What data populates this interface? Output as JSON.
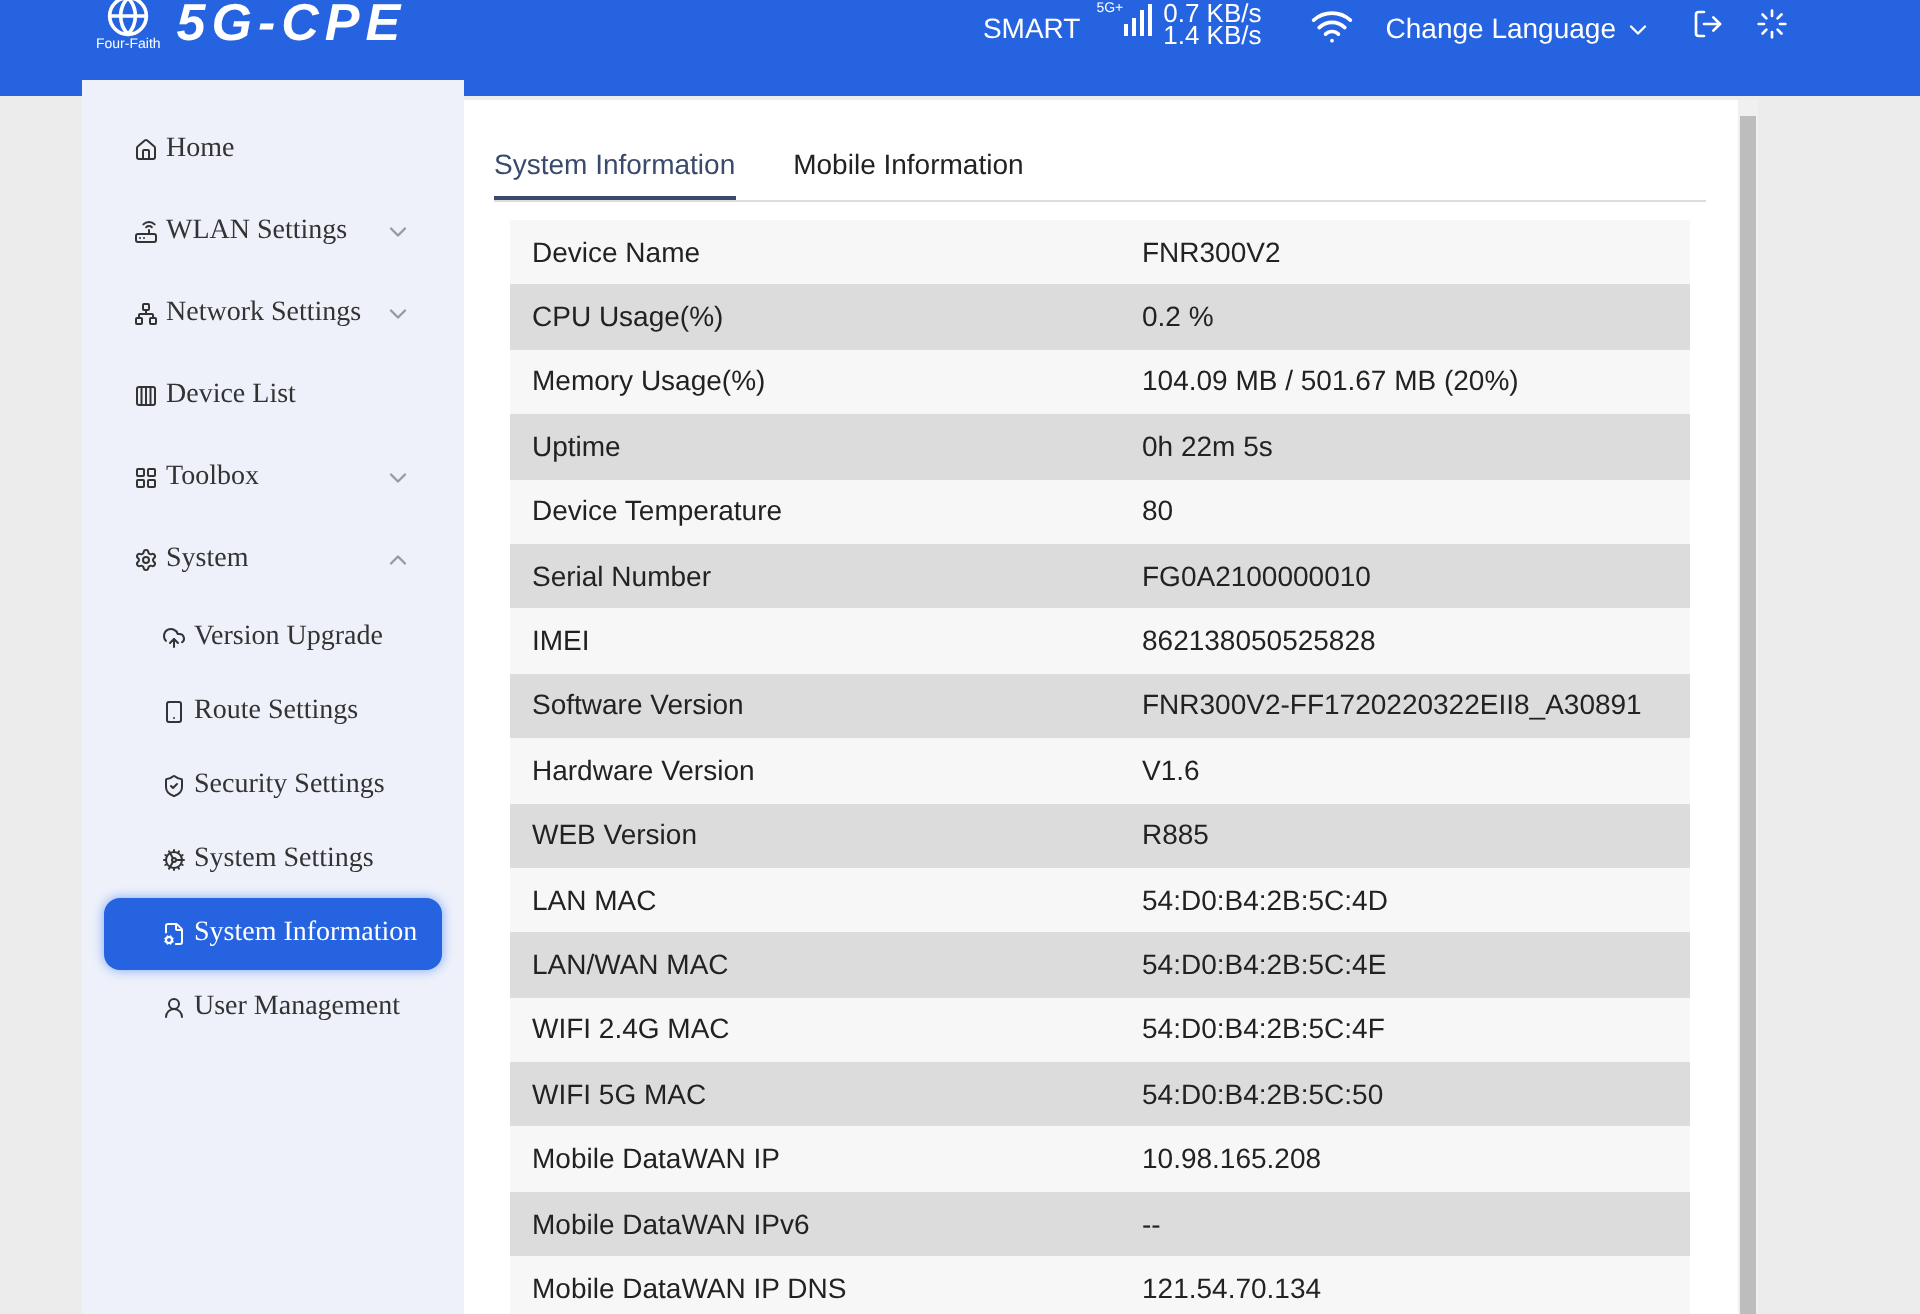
{
  "header": {
    "logo_text": "Four-Faith",
    "title": "5G-CPE",
    "network_mode": "SMART",
    "network_type": "5G+",
    "upload_speed": "0.7 KB/s",
    "download_speed": "1.4 KB/s",
    "language_button": "Change Language"
  },
  "sidebar": {
    "items": [
      {
        "label": "Home"
      },
      {
        "label": "WLAN Settings",
        "expanded": false
      },
      {
        "label": "Network Settings",
        "expanded": false
      },
      {
        "label": "Device List"
      },
      {
        "label": "Toolbox",
        "expanded": false
      },
      {
        "label": "System",
        "expanded": true,
        "children": [
          {
            "label": "Version Upgrade",
            "selected": false
          },
          {
            "label": "Route Settings",
            "selected": false
          },
          {
            "label": "Security Settings",
            "selected": false
          },
          {
            "label": "System Settings",
            "selected": false
          },
          {
            "label": "System Information",
            "selected": true
          },
          {
            "label": "User Management",
            "selected": false
          }
        ]
      }
    ]
  },
  "tabs": [
    {
      "label": "System Information",
      "selected": true
    },
    {
      "label": "Mobile Information",
      "selected": false
    }
  ],
  "table": {
    "rows": [
      [
        "Device Name",
        "FNR300V2"
      ],
      [
        "CPU Usage(%)",
        "0.2 %"
      ],
      [
        "Memory Usage(%)",
        "104.09 MB / 501.67 MB (20%)"
      ],
      [
        "Uptime",
        "0h 22m 5s"
      ],
      [
        "Device Temperature",
        "80"
      ],
      [
        "Serial Number",
        "FG0A2100000010"
      ],
      [
        "IMEI",
        "862138050525828"
      ],
      [
        "Software Version",
        "FNR300V2-FF1720220322EII8_A30891"
      ],
      [
        "Hardware Version",
        "V1.6"
      ],
      [
        "WEB Version",
        "R885"
      ],
      [
        "LAN MAC",
        "54:D0:B4:2B:5C:4D"
      ],
      [
        "LAN/WAN MAC",
        "54:D0:B4:2B:5C:4E"
      ],
      [
        "WIFI 2.4G MAC",
        "54:D0:B4:2B:5C:4F"
      ],
      [
        "WIFI 5G MAC",
        "54:D0:B4:2B:5C:50"
      ],
      [
        "Mobile DataWAN IP",
        "10.98.165.208"
      ],
      [
        "Mobile DataWAN IPv6",
        "--"
      ],
      [
        "Mobile DataWAN IP DNS",
        "121.54.70.134"
      ]
    ]
  }
}
